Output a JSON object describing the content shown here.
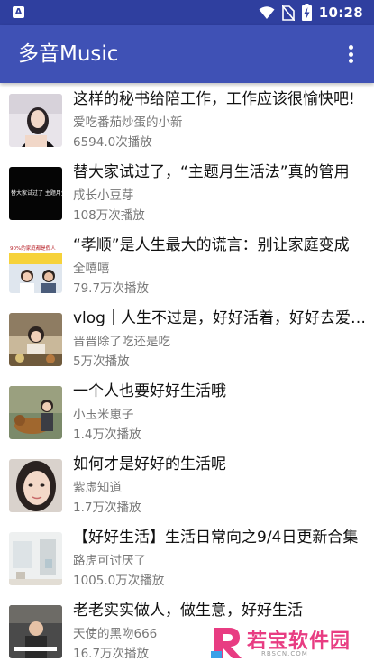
{
  "status_bar": {
    "time": "10:28",
    "icons": [
      "notification-a-icon",
      "wifi-icon",
      "no-sim-icon",
      "battery-charging-icon"
    ]
  },
  "app_bar": {
    "title": "多音Music",
    "menu_icon": "more-vert-icon"
  },
  "items": [
    {
      "title": "这样的秘书给陪工作，工作应该很愉快吧!",
      "artist": "爱吃番茄炒蛋的小新",
      "plays": "6594.0次播放"
    },
    {
      "title": "替大家试过了，“主题月生活法”真的管用",
      "artist": "成长小豆芽",
      "plays": "108万次播放",
      "thumb_text": "替大家试过了 主题月生活法 真的管"
    },
    {
      "title": "“孝顺”是人生最大的谎言：别让家庭变成",
      "artist": "全嘻嘻",
      "plays": "79.7万次播放",
      "thumb_text": "90%的家庭都是假人"
    },
    {
      "title": "vlog｜人生不过是，好好活着，好好去爱…",
      "artist": "晋晋除了吃还是吃",
      "plays": "5万次播放"
    },
    {
      "title": "一个人也要好好生活哦",
      "artist": "小玉米崽子",
      "plays": "1.4万次播放"
    },
    {
      "title": "如何才是好好的生活呢",
      "artist": "紫虚知道",
      "plays": "1.7万次播放"
    },
    {
      "title": "【好好生活】生活日常向之9/4日更新合集",
      "artist": "路虎可讨厌了",
      "plays": "1005.0万次播放"
    },
    {
      "title": "老老实实做人，做生意，好好生活",
      "artist": "天使的黑吻666",
      "plays": "16.7万次播放"
    }
  ],
  "watermark": {
    "text": "若宝软件园",
    "sub": "RBSCN.COM"
  }
}
